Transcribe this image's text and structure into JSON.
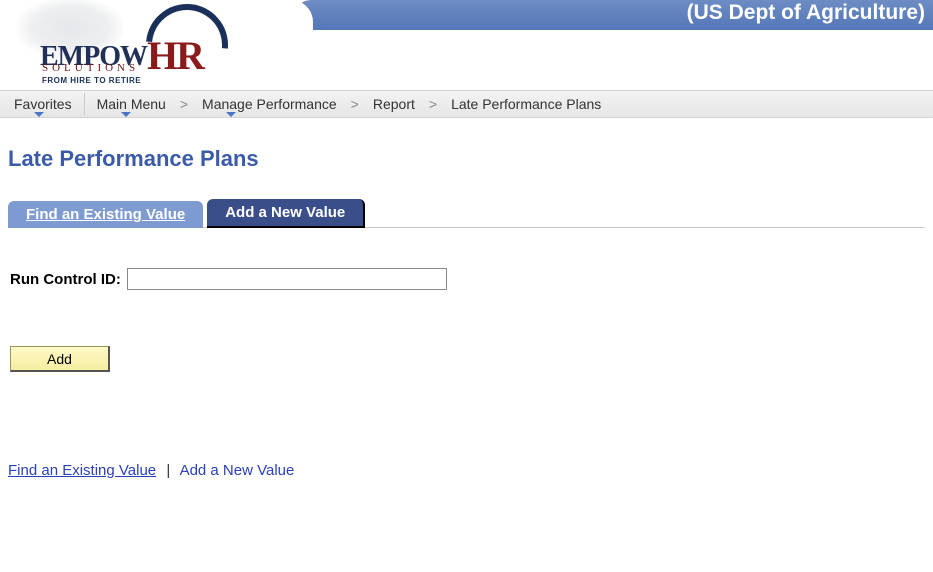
{
  "header": {
    "banner_text": "(US Dept of Agriculture)",
    "logo": {
      "line1_a": "EMPOW",
      "line1_b": "HR",
      "line2": "SOLUTIONS",
      "line3": "FROM HIRE TO RETIRE"
    }
  },
  "breadcrumb": {
    "items": [
      {
        "label": "Favorites",
        "has_menu": true
      },
      {
        "label": "Main Menu",
        "has_menu": true
      },
      {
        "label": "Manage Performance",
        "has_menu": true
      },
      {
        "label": "Report",
        "has_menu": false
      },
      {
        "label": "Late Performance Plans",
        "has_menu": false
      }
    ],
    "separator": ">"
  },
  "page": {
    "title": "Late Performance Plans"
  },
  "tabs": {
    "find_label": "Find an Existing Value",
    "add_label": "Add a New Value",
    "active": "add"
  },
  "form": {
    "run_control_label": "Run Control ID:",
    "run_control_value": "",
    "add_button_label": "Add"
  },
  "bottom_links": {
    "find_label": "Find an Existing Value",
    "add_label": "Add a New Value"
  }
}
